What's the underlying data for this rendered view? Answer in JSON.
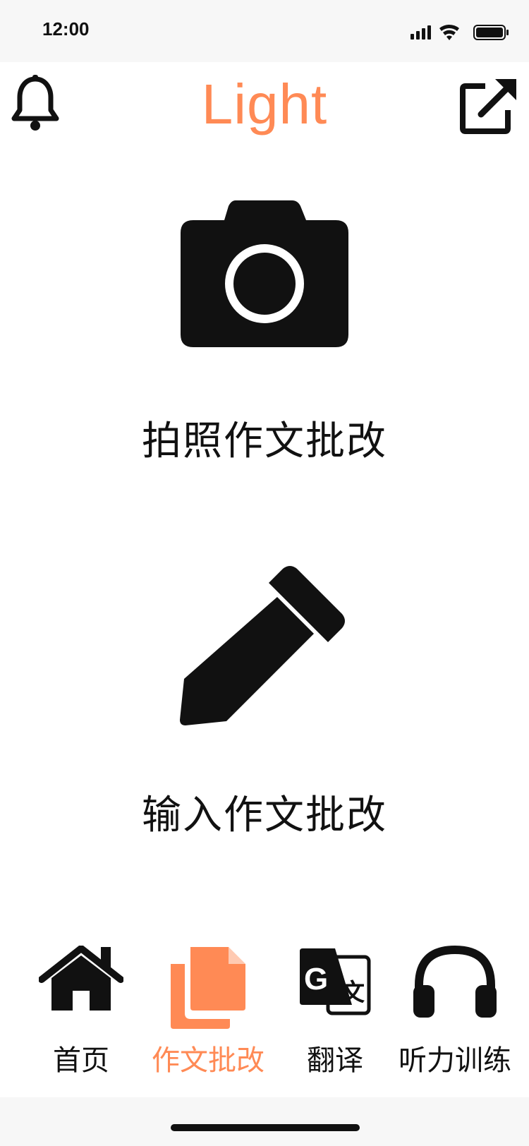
{
  "status_bar": {
    "time": "12:00"
  },
  "header": {
    "title": "Light",
    "left_icon": "bell-icon",
    "right_icon": "share-icon"
  },
  "actions": [
    {
      "icon": "camera-icon",
      "label": "拍照作文批改"
    },
    {
      "icon": "pencil-icon",
      "label": "输入作文批改"
    }
  ],
  "tab_bar": {
    "active_index": 1,
    "tabs": [
      {
        "icon": "home-icon",
        "label": "首页"
      },
      {
        "icon": "documents-icon",
        "label": "作文批改"
      },
      {
        "icon": "translate-icon",
        "label": "翻译"
      },
      {
        "icon": "headphones-icon",
        "label": "听力训练"
      }
    ]
  },
  "colors": {
    "accent": "#ff8a55",
    "icon": "#111111",
    "bar_background": "#f7f7f7"
  }
}
